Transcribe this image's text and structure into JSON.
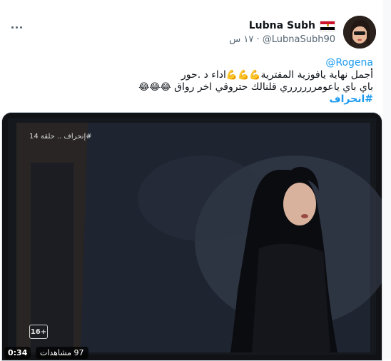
{
  "header": {
    "display_name": "Lubna Subh",
    "flag_icon": "egypt-flag",
    "handle": "@LubnaSubh90",
    "time": "١٧ س",
    "separator": "·"
  },
  "tweet": {
    "mention": "@Rogena",
    "line2_text": "اداء د .حور",
    "line2_text2": "أجمل نهاية يافوزية المفترية",
    "line2_emoji": "💪💪💪",
    "line3_text": "باي باي ياعومرررررري قلنالك حتروقي اخر رواق",
    "line3_emoji": "😂😂😂",
    "hashtag": "#انحراف"
  },
  "media": {
    "overlay_title": "#إنحراف .. حلقة 14",
    "rating": "16+",
    "views": "97 مشاهدات",
    "duration": "0:34"
  },
  "colors": {
    "link": "#1d9bf0",
    "text": "#0f1419",
    "secondary": "#536471"
  }
}
